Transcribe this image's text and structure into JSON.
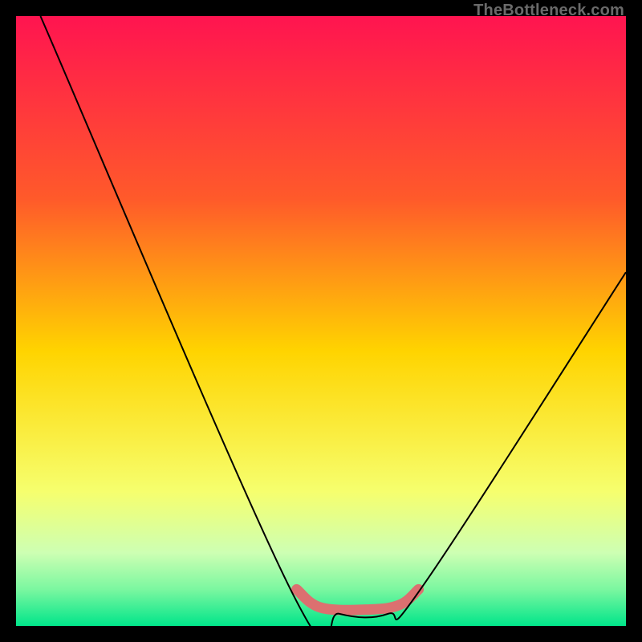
{
  "watermark": "TheBottleneck.com",
  "chart_data": {
    "type": "line",
    "title": "",
    "xlabel": "",
    "ylabel": "",
    "xlim": [
      0,
      100
    ],
    "ylim": [
      0,
      100
    ],
    "background_gradient_stops": [
      {
        "offset": 0,
        "color": "#ff1450"
      },
      {
        "offset": 0.3,
        "color": "#ff5a2a"
      },
      {
        "offset": 0.55,
        "color": "#ffd400"
      },
      {
        "offset": 0.78,
        "color": "#f6ff6e"
      },
      {
        "offset": 0.88,
        "color": "#cdffb3"
      },
      {
        "offset": 0.94,
        "color": "#7bf7a0"
      },
      {
        "offset": 1.0,
        "color": "#00e58a"
      }
    ],
    "series": [
      {
        "name": "curve",
        "stroke": "#000000",
        "stroke_width": 2,
        "points": [
          {
            "x": 4,
            "y": 100
          },
          {
            "x": 45,
            "y": 6
          },
          {
            "x": 53,
            "y": 2
          },
          {
            "x": 61,
            "y": 2
          },
          {
            "x": 67,
            "y": 7
          },
          {
            "x": 100,
            "y": 58
          }
        ]
      },
      {
        "name": "bottom-marker",
        "stroke": "#dc7070",
        "stroke_width": 13,
        "linecap": "round",
        "points": [
          {
            "x": 46,
            "y": 6
          },
          {
            "x": 50,
            "y": 3
          },
          {
            "x": 58,
            "y": 2.7
          },
          {
            "x": 63,
            "y": 3.5
          },
          {
            "x": 66,
            "y": 6
          }
        ]
      }
    ]
  }
}
